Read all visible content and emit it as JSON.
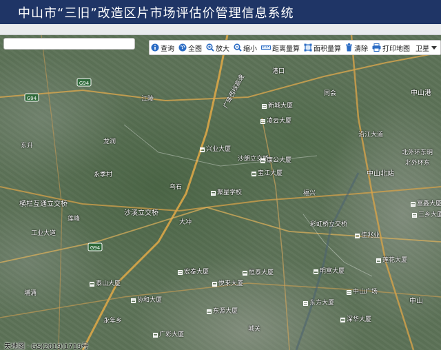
{
  "app": {
    "title": "中山市“三旧”改造区片市场评估价管理信息系统"
  },
  "search": {
    "value": "",
    "placeholder": ""
  },
  "toolbar": {
    "query": "查询",
    "full_extent": "全图",
    "zoom_in": "放大",
    "zoom_out": "缩小",
    "measure_distance": "距离量算",
    "measure_area": "面积量算",
    "clear": "清除",
    "print_map": "打印地图",
    "basemap": "卫星"
  },
  "colors": {
    "title_bar": "#1f3566",
    "toolbar_icon": "#2b6cc4",
    "road": "#d9a648"
  },
  "map_labels": {
    "expressway": "广珠西线高速",
    "west_ring_1": "北外环东明",
    "west_ring_2": "北外环东",
    "zhongshan_north": "中山北站",
    "shalang_overpass": "沙朗立交桥",
    "shaxi_overpass": "沙溪立交桥",
    "henglan_overpass": "横栏互通立交桥",
    "caihong_overpass": "彩虹桥立交桥",
    "zhongshan_port": "中山港",
    "jingye_school": "聚星学校",
    "yongjiacun": "永季村",
    "lianfeng": "莲峰",
    "dongsheng": "东升",
    "jiang": "江陵",
    "wu": "乌石",
    "dachong": "大冲",
    "fuxing": "福兴",
    "gangkou": "港口",
    "tonghui": "同会",
    "pulu": "埔涌",
    "yanjiang": "沿江大道",
    "zhongshan": "中山",
    "longrun": "龙润",
    "xingye": "兴业大厦",
    "kanggong": "康公大厦",
    "baojiang": "宝江大厦",
    "xincheng": "新城大厦",
    "lingyun": "凌云大厦",
    "fuxin": "富鑫大厦",
    "sanxiang": "三乡大厦",
    "jiazhao": "佳兆业",
    "hongtai": "宏泰大厦",
    "mingfu": "明富大厦",
    "zhongshan_plaza": "中山广场",
    "yuelai": "悦来大厦",
    "hengtai": "恒泰大厦",
    "dongfang": "东方大厦",
    "xiehe": "协和大厦",
    "dongyuan": "东源大厦",
    "shenhua": "深华大厦",
    "guangcai": "广彩大厦",
    "taishan": "泰山大厦",
    "lotus": "莲花大厦",
    "yongnianxiang": "永年乡",
    "chengguan": "城关",
    "gongye": "工业大道"
  },
  "road_shields": {
    "g94_a": "G94",
    "g94_b": "G94",
    "g94_c": "G94"
  },
  "footer": {
    "attribution": "天地图 · GS(2019)1719号"
  }
}
